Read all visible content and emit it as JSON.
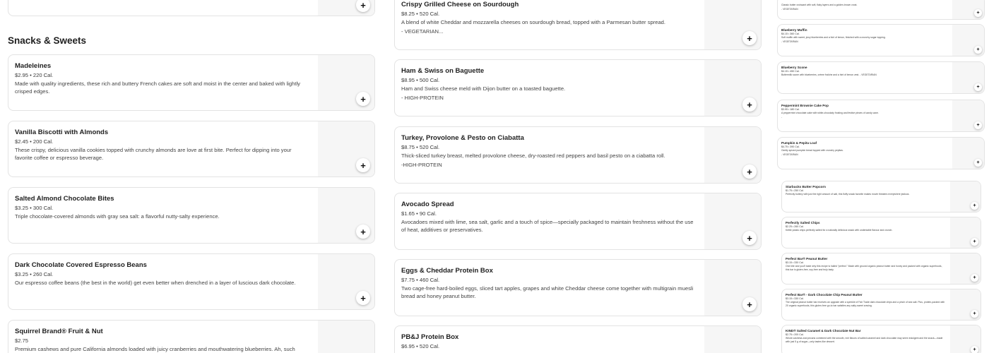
{
  "section_title": "Snacks & Sweets",
  "add_symbol": "+",
  "col_a_items": [
    {
      "title": "Madeleines",
      "meta": "$2.95 • 220 Cal.",
      "desc": "Made with quality ingredients, these rich and buttery French cakes are soft and moist in the center and baked with lightly crisped edges."
    },
    {
      "title": "Vanilla Biscotti with Almonds",
      "meta": "$2.45 • 200 Cal.",
      "desc": "These crispy, delicious vanilla cookies topped with crunchy almonds are love at first bite. Perfect for dipping into your favorite coffee or espresso beverage."
    },
    {
      "title": "Salted Almond Chocolate Bites",
      "meta": "$3.25 • 300 Cal.",
      "desc": "Triple chocolate-covered almonds with gray sea salt: a flavorful nutty-salty experience."
    },
    {
      "title": "Dark Chocolate Covered Espresso Beans",
      "meta": "$3.25 • 260 Cal.",
      "desc": "Our espresso coffee beans (the best in the world) get even better when drenched in a layer of luscious dark chocolate."
    },
    {
      "title": "Squirrel Brand® Fruit & Nut",
      "meta": "$2.75",
      "desc": "Premium cashews and pure California almonds loaded with juicy cranberries and mouthwatering blueberries. Ah, such"
    }
  ],
  "col_b_items": [
    {
      "title": "Crispy Grilled Cheese on Sourdough",
      "meta": "$8.25 • 520 Cal.",
      "desc": "A blend of white Cheddar and mozzarella cheeses on sourdough bread, topped with a Parmesan butter spread.",
      "tag": "- VEGETARIAN..."
    },
    {
      "title": "Ham & Swiss on Baguette",
      "meta": "$8.95 • 500 Cal.",
      "desc": "Ham and Swiss cheese meld with Dijon butter on a toasted baguette.",
      "tag": "- HIGH-PROTEIN"
    },
    {
      "title": "Turkey, Provolone & Pesto on Ciabatta",
      "meta": "$8.75 • 520 Cal.",
      "desc": "Thick-sliced turkey breast, melted provolone cheese, dry-roasted red peppers and basil pesto on a ciabatta roll.",
      "tag": "-HIGH-PROTEIN"
    },
    {
      "title": "Avocado Spread",
      "meta": "$1.65 • 90 Cal.",
      "desc": "Avocadoes mixed with lime, sea salt, garlic and a touch of spice—specially packaged to maintain freshness without the use of heat, additives or preservatives.",
      "tag": ""
    },
    {
      "title": "Eggs & Cheddar Protein Box",
      "meta": "$7.75 • 460 Cal.",
      "desc": "Two cage-free hard-boiled eggs, sliced tart apples, grapes and white Cheddar cheese come together with multigrain muesli bread and honey peanut butter.",
      "tag": ""
    },
    {
      "title": "PB&J Protein Box",
      "meta": "$6.95 • 520 Cal.",
      "desc": "",
      "tag": ""
    }
  ],
  "col_c_top_desc": "Classic butter croissant with soft, flaky layers and a golden-brown crust.",
  "col_c_top_tag": "- VEGETARIAN",
  "col_c_items": [
    {
      "title": "Blueberry Muffin",
      "meta": "$4.15 • 360 Cal.",
      "desc": "Soft muffin with sweet, juicy blueberries and a hint of lemon, finished with a crunchy sugar topping.",
      "tag": "- VEGETARIAN"
    },
    {
      "title": "Blueberry Scone",
      "meta": "$4.15 • 450 Cal.",
      "desc": "Buttermilk scone with blueberries, crème fraîche and a hint of lemon zest. - VEGETARIAN",
      "tag": ""
    },
    {
      "title": "Peppermint Brownie Cake Pop",
      "meta": "$3.95 • 180 Cal.",
      "desc": "A peppermint chocolate cake with white-chocolaty frosting and festive pieces of candy cane.",
      "tag": "-"
    },
    {
      "title": "Pumpkin & Pepita Loaf",
      "meta": "$4.75 • 390 Cal.",
      "desc": "Gently spiced pumpkin bread topped with crunchy pepitas.",
      "tag": "- VEGETARIAN"
    },
    {
      "title": "Starbucks Butter Popcorn",
      "meta": "$1.75 • 250 Cal.",
      "desc": "Perfectly buttery with just the right amount of salt, this fluffy snack favorite makes movie theaters everywhere jealous.",
      "tag": ""
    },
    {
      "title": "Perfectly Salted Chips",
      "meta": "$2.25 • 260 Cal.",
      "desc": "Kettle potato chips perfectly salted for a naturally delicious snack with undeniable flavour and crunch.",
      "tag": ""
    },
    {
      "title": "Perfect Bar® Peanut Butter",
      "meta": "$3.15 • 330 Cal.",
      "desc": "One bite and you'll taste why this recipe is hailed \"perfect.\" Made with ground organic peanut butter and honey and packed with organic superfoods, this bar is gluten-free, soy-free and truly tasty.",
      "tag": ""
    },
    {
      "title": "Perfect Bar® - Dark Chocolate Chip Peanut Butter",
      "meta": "$3.15 • 330 Cal.",
      "desc": "The original peanut butter bar receives an upgrade with a sprinkle of Fair Trade dark chocolate chips and a pinch of sea salt. Plus, protein-packed with 20 organic superfoods, this gluten-free go-to bar satisfies any salty-sweet craving.",
      "tag": ""
    },
    {
      "title": "KIND® Salted Caramel & Dark Chocolate Nut Bar",
      "meta": "$2.75 • 200 Cal.",
      "desc": "Whole cashews and pecans combined with the smooth, rich flavors of salted caramel and dark chocolate may seem indulgent and the snack—made with just 5 g of sugar—only tastes like dessert.",
      "tag": ""
    }
  ]
}
